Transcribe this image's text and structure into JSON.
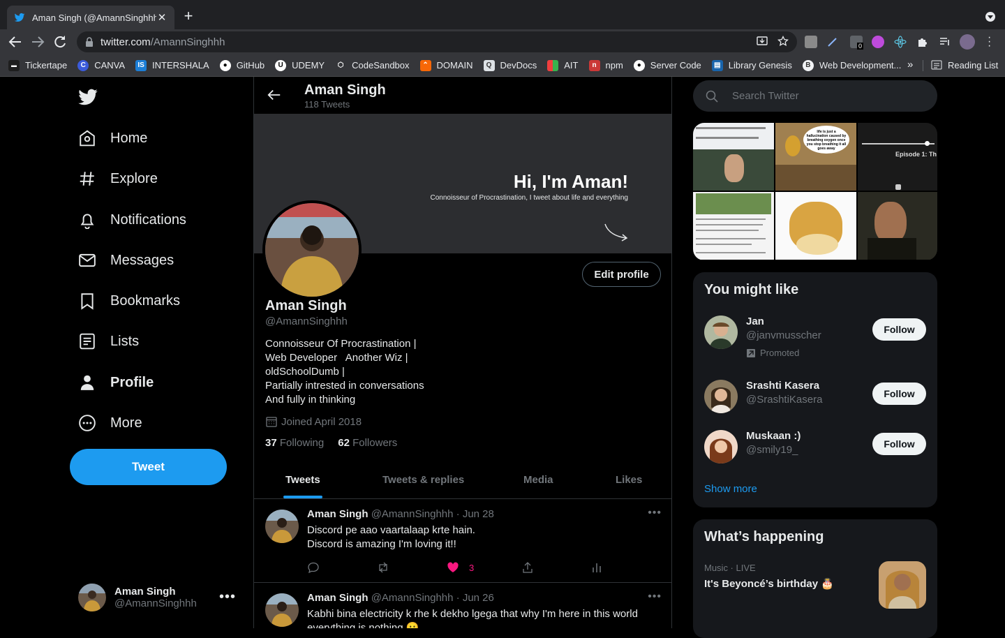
{
  "browser": {
    "tab_title": "Aman Singh (@AmannSinghhh",
    "url_host": "twitter.com",
    "url_path": "/AmannSinghhh",
    "extension_badge": "0",
    "bookmarks": [
      {
        "label": "Tickertape",
        "icon": "tickertape-icon",
        "color": "#1e1e1e"
      },
      {
        "label": "CANVA",
        "icon": "canva-icon",
        "color": "#3b5bdb"
      },
      {
        "label": "INTERSHALA",
        "icon": "intershala-icon",
        "color": "#1c7ed6"
      },
      {
        "label": "GitHub",
        "icon": "github-icon",
        "color": "#000000"
      },
      {
        "label": "UDEMY",
        "icon": "udemy-icon",
        "color": "#000000"
      },
      {
        "label": "CodeSandbox",
        "icon": "codesandbox-icon",
        "color": "#35363a"
      },
      {
        "label": "DOMAIN",
        "icon": "domain-icon",
        "color": "#f76707"
      },
      {
        "label": "DevDocs",
        "icon": "devdocs-icon",
        "color": "#495057"
      },
      {
        "label": "AIT",
        "icon": "ait-icon",
        "color": "#f59f00"
      },
      {
        "label": "npm",
        "icon": "npm-icon",
        "color": "#cb3837"
      },
      {
        "label": "Server Code",
        "icon": "github-icon",
        "color": "#000000"
      },
      {
        "label": "Library Genesis",
        "icon": "library-icon",
        "color": "#1864ab"
      },
      {
        "label": "Web Development...",
        "icon": "web-dev-icon",
        "color": "#e9ecef"
      }
    ],
    "bookmarks_overflow": "»",
    "reading_list": "Reading List"
  },
  "nav": {
    "items": [
      {
        "label": "Home",
        "icon": "home-icon"
      },
      {
        "label": "Explore",
        "icon": "hashtag-icon"
      },
      {
        "label": "Notifications",
        "icon": "bell-icon"
      },
      {
        "label": "Messages",
        "icon": "mail-icon"
      },
      {
        "label": "Bookmarks",
        "icon": "bookmark-icon"
      },
      {
        "label": "Lists",
        "icon": "list-icon"
      },
      {
        "label": "Profile",
        "icon": "person-icon"
      },
      {
        "label": "More",
        "icon": "more-circle-icon"
      }
    ],
    "tweet_button": "Tweet",
    "account": {
      "name": "Aman Singh",
      "handle": "@AmannSinghhh"
    }
  },
  "profile": {
    "header_name": "Aman Singh",
    "tweet_count": "118 Tweets",
    "banner_title": "Hi, I'm Aman!",
    "banner_subtitle": "Connoisseur of Procrastination, I tweet about life and everything",
    "edit_profile": "Edit profile",
    "name": "Aman Singh",
    "handle": "@AmannSinghhh",
    "bio": "Connoisseur Of Procrastination |\nWeb Developer   Another Wiz |\noldSchoolDumb |\nPartially intrested in conversations\nAnd fully in thinking",
    "joined": "Joined April 2018",
    "following_count": "37",
    "following_label": "Following",
    "followers_count": "62",
    "followers_label": "Followers",
    "tabs": [
      "Tweets",
      "Tweets & replies",
      "Media",
      "Likes"
    ]
  },
  "tweets": [
    {
      "name": "Aman Singh",
      "meta": "@AmannSinghhh · Jun 28",
      "text": "Discord pe aao vaartalaap krte hain.\nDiscord is amazing I'm loving it!!",
      "likes": "3"
    },
    {
      "name": "Aman Singh",
      "meta": "@AmannSinghhh · Jun 26",
      "text": "Kabhi bina electricity k rhe k dekho lgega that why I'm here in this world\neverything is nothing 😶"
    }
  ],
  "sidebar": {
    "search_placeholder": "Search Twitter",
    "media_banner_texts": [
      "life is just a hallucination caused by breathing oxygen once you stop breathing it all goes away",
      "Episode 1: Th"
    ],
    "you_might_like": {
      "title": "You might like",
      "people": [
        {
          "name": "Jan",
          "handle": "@janvmusscher",
          "promoted": "Promoted",
          "button": "Follow"
        },
        {
          "name": "Srashti Kasera",
          "handle": "@SrashtiKasera",
          "button": "Follow"
        },
        {
          "name": "Muskaan :)",
          "handle": "@smily19_",
          "button": "Follow"
        }
      ],
      "show_more": "Show more"
    },
    "whats_happening": {
      "title": "What’s happening",
      "trend_meta": "Music · LIVE",
      "trend_title": "It's Beyoncé’s birthday 🎂"
    }
  },
  "colors": {
    "accent": "#1d9bf0",
    "like": "#f91880",
    "background": "#000000"
  }
}
